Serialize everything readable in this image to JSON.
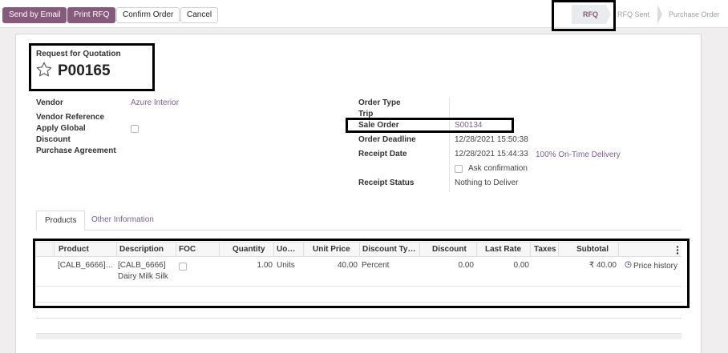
{
  "toolbar": {
    "send_email": "Send by Email",
    "print_rfq": "Print RFQ",
    "confirm_order": "Confirm Order",
    "cancel": "Cancel"
  },
  "statusbar": [
    {
      "label": "RFQ",
      "active": true
    },
    {
      "label": "RFQ Sent",
      "active": false
    },
    {
      "label": "Purchase Order",
      "active": false
    }
  ],
  "header": {
    "doc_type": "Request for Quotation",
    "doc_number": "P00165",
    "star_icon": "star-outline-icon"
  },
  "left_fields": {
    "vendor_label": "Vendor",
    "vendor_value": "Azure Interior",
    "vendor_reference_label": "Vendor Reference",
    "apply_global_label": "Apply Global",
    "discount_label": "Discount",
    "purchase_agreement_label": "Purchase Agreement"
  },
  "right_fields": {
    "order_type_label": "Order Type",
    "trip_label": "Trip",
    "sale_order_label": "Sale Order",
    "sale_order_value": "S00134",
    "order_deadline_label": "Order Deadline",
    "order_deadline_value": "12/28/2021 15:50:38",
    "receipt_date_label": "Receipt Date",
    "receipt_date_value": "12/28/2021 15:44:33",
    "on_time_delivery": "100% On-Time Delivery",
    "ask_confirmation": "Ask confirmation",
    "receipt_status_label": "Receipt Status",
    "receipt_status_value": "Nothing to Deliver"
  },
  "tabs": [
    {
      "label": "Products",
      "active": true
    },
    {
      "label": "Other Information",
      "active": false
    }
  ],
  "lines": {
    "columns": [
      "Product",
      "Description",
      "FOC",
      "Quantity",
      "Uo…",
      "Unit Price",
      "Discount Ty…",
      "Discount",
      "Last Rate",
      "Taxes",
      "Subtotal"
    ],
    "rows": [
      {
        "product": "[CALB_6666]…",
        "description_1": "[CALB_6666]",
        "description_2": "Dairy Milk Silk",
        "quantity": "1.00",
        "uom": "Units",
        "unit_price": "40.00",
        "discount_type": "Percent",
        "discount": "0.00",
        "last_rate": "0.00",
        "taxes": "",
        "subtotal": "₹ 40.00",
        "history": "Price history"
      }
    ]
  },
  "colors": {
    "primary": "#875a7b",
    "link": "#7c5f95"
  }
}
